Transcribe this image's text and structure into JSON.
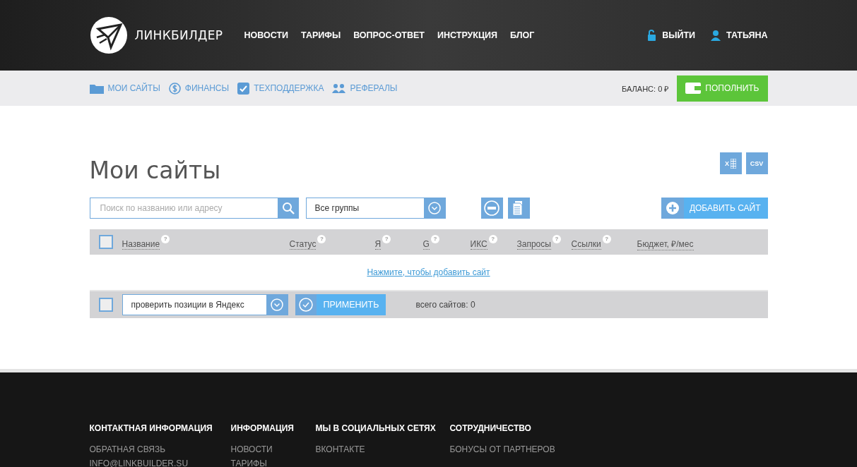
{
  "header": {
    "logo": "ЛИНКБИЛДЕР",
    "nav": [
      "НОВОСТИ",
      "ТАРИФЫ",
      "ВОПРОС-ОТВЕТ",
      "ИНСТРУКЦИЯ",
      "БЛОГ"
    ],
    "logout": "ВЫЙТИ",
    "user": "ТАТЬЯНА"
  },
  "subnav": {
    "items": [
      {
        "kind": "folder",
        "label": "МОИ САЙТЫ"
      },
      {
        "kind": "money",
        "label": "ФИНАНСЫ"
      },
      {
        "kind": "support",
        "label": "ТЕХПОДДЕРЖКА"
      },
      {
        "kind": "people",
        "label": "РЕФЕРАЛЫ"
      }
    ],
    "balance": "БАЛАНС: 0 ₽",
    "topup": "ПОПОЛНИТЬ"
  },
  "page": {
    "title": "Мои сайты",
    "exports": [
      {
        "kind": "xls",
        "label": "X"
      },
      {
        "kind": "csv",
        "label": "CSV"
      }
    ],
    "search": {
      "placeholder": "Поиск по названию или адресу"
    },
    "group_select": "Все группы",
    "add_button": "ДОБАВИТЬ САЙТ"
  },
  "table": {
    "select_all": {
      "checked": false
    },
    "columns": [
      {
        "label": "Название",
        "help": "?"
      },
      {
        "label": "Статус",
        "help": "?"
      },
      {
        "label": "Я",
        "help": "?"
      },
      {
        "label": "G",
        "help": "?"
      },
      {
        "label": "ИКС",
        "help": "?"
      },
      {
        "label": "Запросы",
        "help": "?"
      },
      {
        "label": "Ссылки",
        "help": "?"
      },
      {
        "label": "Бюджет, ₽/мес"
      }
    ],
    "empty_link": "Нажмите, чтобы добавить сайт"
  },
  "bulk": {
    "checked": false,
    "action": "проверить позиции в Яндекс",
    "apply": "ПРИМЕНИТЬ",
    "total": "всего сайтов: 0"
  },
  "footer": {
    "columns": [
      {
        "title": "КОНТАКТНАЯ ИНФОРМАЦИЯ",
        "links": [
          "ОБРАТНАЯ СВЯЗЬ",
          "INFO@LINKBUILDER.SU"
        ]
      },
      {
        "title": "ИНФОРМАЦИЯ",
        "links": [
          "НОВОСТИ",
          "ТАРИФЫ"
        ]
      },
      {
        "title": "МЫ В СОЦИАЛЬНЫХ СЕТЯХ",
        "links": [
          "ВКОНТАКТЕ"
        ]
      },
      {
        "title": "СОТРУДНИЧЕСТВО",
        "links": [
          "БОНУСЫ ОТ ПАРТНЕРОВ"
        ]
      }
    ]
  }
}
